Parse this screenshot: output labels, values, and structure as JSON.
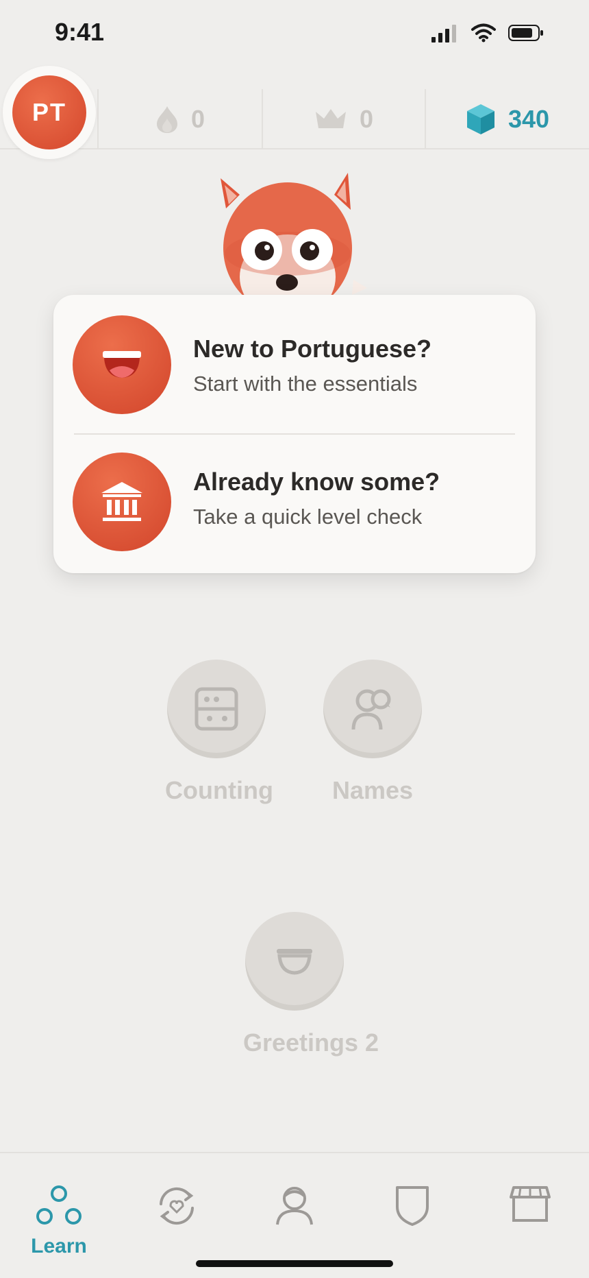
{
  "status_bar": {
    "time": "9:41"
  },
  "header": {
    "avatar_initials": "PT",
    "streak": "0",
    "crowns": "0",
    "gems": "340",
    "gems_color": "#2c97aa"
  },
  "options": [
    {
      "title": "New to Portuguese?",
      "subtitle": "Start with the essentials",
      "icon": "smile-mouth-icon"
    },
    {
      "title": "Already know some?",
      "subtitle": "Take a quick level check",
      "icon": "bank-building-icon"
    }
  ],
  "path_nodes": [
    {
      "label": "Counting",
      "icon": "abacus-icon",
      "locked": true
    },
    {
      "label": "Names",
      "icon": "person-speech-icon",
      "locked": true
    },
    {
      "label": "Greetings 2",
      "icon": "smile-mouth-icon",
      "locked": true
    }
  ],
  "bottom_nav": {
    "items": [
      {
        "label": "Learn",
        "icon": "learn-circles-icon",
        "active": true
      },
      {
        "label": "",
        "icon": "practice-refresh-icon",
        "active": false
      },
      {
        "label": "",
        "icon": "profile-icon",
        "active": false
      },
      {
        "label": "",
        "icon": "shield-icon",
        "active": false
      },
      {
        "label": "",
        "icon": "shop-icon",
        "active": false
      }
    ]
  },
  "colors": {
    "accent": "#d9502f",
    "teal": "#2c97aa",
    "background": "#efeeec"
  }
}
